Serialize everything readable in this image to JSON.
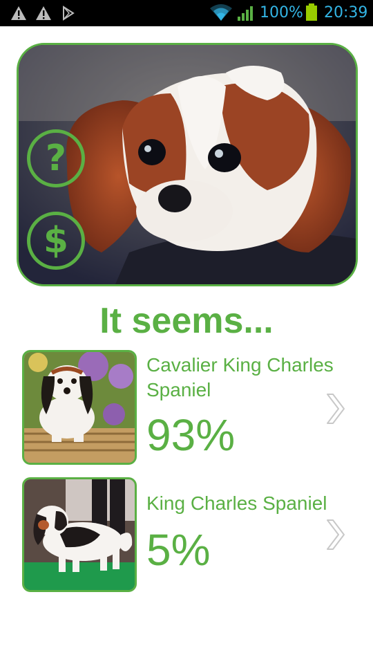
{
  "status_bar": {
    "battery": "100%",
    "time": "20:39",
    "icons": [
      "warning-icon",
      "warning-icon",
      "play-store-icon",
      "wifi-icon",
      "signal-icon",
      "battery-icon"
    ]
  },
  "hero": {
    "image": "dog-photo",
    "buttons": [
      {
        "icon": "question-mark-icon",
        "glyph": "?"
      },
      {
        "icon": "dollar-icon",
        "glyph": "$"
      }
    ]
  },
  "heading": "It seems...",
  "results": [
    {
      "name": "Cavalier King Charles Spaniel",
      "percent": "93%",
      "image": "cavalier-thumbnail",
      "icon": "chevron-right-icon"
    },
    {
      "name": "King Charles Spaniel",
      "percent": "5%",
      "image": "king-charles-thumbnail",
      "icon": "chevron-right-icon"
    }
  ],
  "colors": {
    "accent": "#5ab044",
    "status_text": "#33b5e5"
  }
}
